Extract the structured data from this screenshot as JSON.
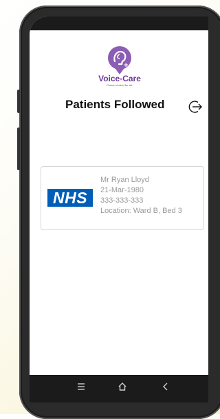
{
  "brand": {
    "name": "Voice-Care",
    "tagline": "Peace of mind for all."
  },
  "header": {
    "title": "Patients Followed",
    "logout_icon": "logout-icon"
  },
  "patients": [
    {
      "provider_badge": "NHS",
      "name": "Mr Ryan Lloyd",
      "dob": "21-Mar-1980",
      "id": "333-333-333",
      "location": "Location: Ward B, Bed 3"
    }
  ],
  "nav": {
    "recents_icon": "recents-icon",
    "home_icon": "home-icon",
    "back_icon": "back-icon"
  },
  "colors": {
    "brand_purple": "#6c3b94",
    "nhs_blue": "#005eb8",
    "card_text": "#9a9a9a"
  }
}
